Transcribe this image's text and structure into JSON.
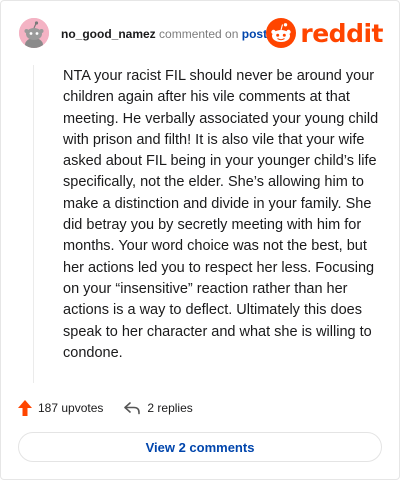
{
  "comment": {
    "username": "no_good_namez",
    "action_text": "commented on",
    "post_link_label": "post",
    "avatar_icon": "snoo-avatar-icon",
    "body": "NTA your racist FIL should never be around your children again after his vile comments at that meeting. He verbally associated your young child with prison and filth! It is also vile that your wife asked about FIL being in your younger child’s life specifically, not the elder. She’s allowing him to make a distinction and divide in your family. She did betray you by secretly meeting with him for months. Your word choice was not the best, but her actions led you to respect her less. Focusing on your “insensitive” reaction rather than her actions is a way to deflect. Ultimately this does speak to her character and what she is willing to condone.",
    "upvotes_label": "187 upvotes",
    "replies_label": "2 replies"
  },
  "brand": {
    "logo_text": "reddit",
    "logo_icon": "reddit-snoo-icon",
    "accent_color": "#ff4500"
  },
  "footer": {
    "view_comments_label": "View 2 comments"
  },
  "colors": {
    "link": "#0045ac",
    "upvote": "#ff4500",
    "text": "#1a1a1b",
    "muted": "#7c7c7c"
  }
}
